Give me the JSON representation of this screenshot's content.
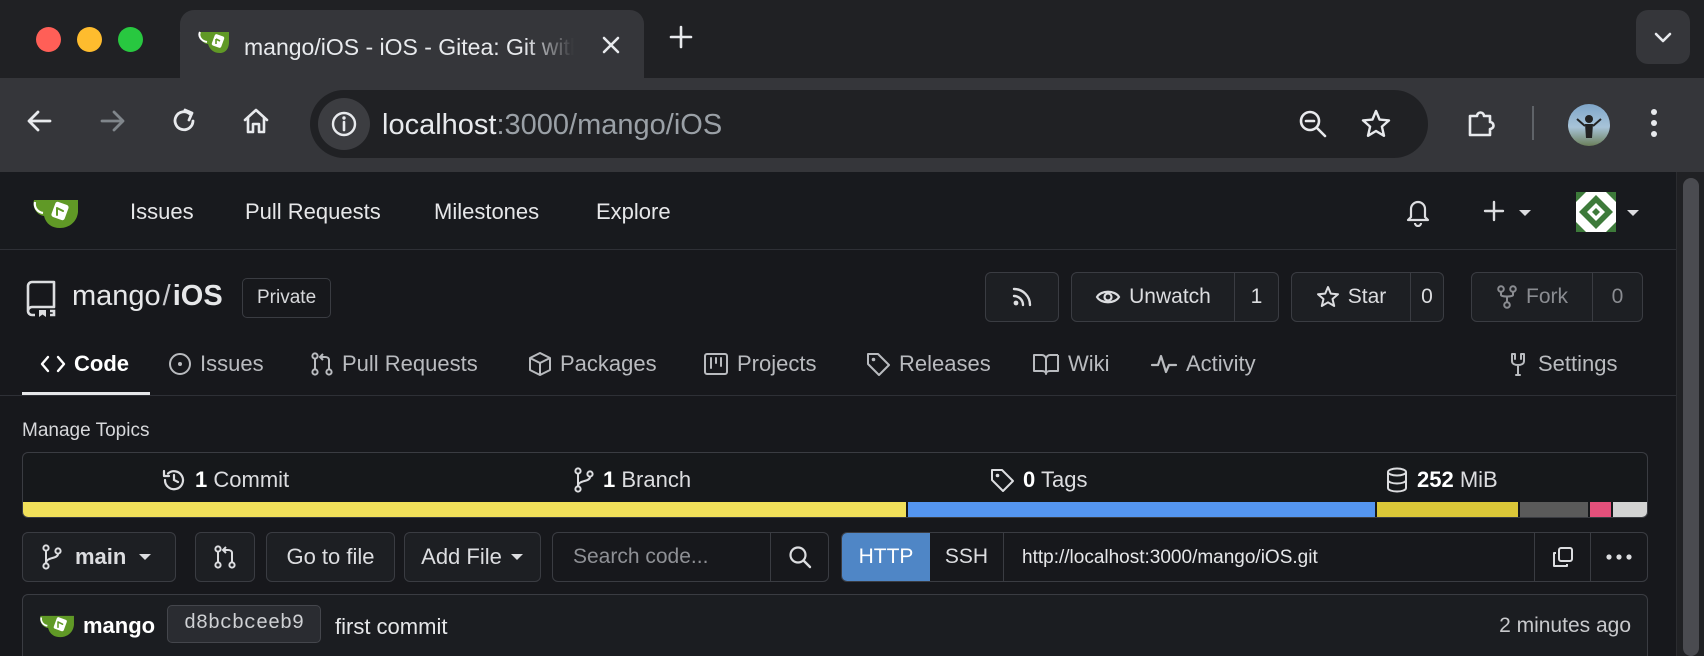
{
  "browser": {
    "tab_title": "mango/iOS - iOS - Gitea: Git with a cup of tea",
    "url_host": "localhost",
    "url_rest": ":3000/mango/iOS"
  },
  "navbar": {
    "items": [
      "Issues",
      "Pull Requests",
      "Milestones",
      "Explore"
    ]
  },
  "repo": {
    "owner": "mango",
    "separator": "/",
    "name": "iOS",
    "visibility": "Private"
  },
  "actions": {
    "unwatch_label": "Unwatch",
    "watch_count": "1",
    "star_label": "Star",
    "star_count": "0",
    "fork_label": "Fork",
    "fork_count": "0"
  },
  "tabs": [
    "Code",
    "Issues",
    "Pull Requests",
    "Packages",
    "Projects",
    "Releases",
    "Wiki",
    "Activity",
    "Settings"
  ],
  "manage_topics": "Manage Topics",
  "stats": {
    "commits_count": "1",
    "commits_label": "Commit",
    "branches_count": "1",
    "branches_label": "Branch",
    "tags_count": "0",
    "tags_label": "Tags",
    "size_value": "252",
    "size_unit": "MiB"
  },
  "language_bar": [
    {
      "color": "#f1e05a",
      "percent": 54.5
    },
    {
      "color": "#5495f0",
      "percent": 28.9
    },
    {
      "color": "#dbc738",
      "percent": 8.8
    },
    {
      "color": "#5a5a5a",
      "percent": 4.3
    },
    {
      "color": "#e4507b",
      "percent": 1.4
    },
    {
      "color": "#d3d3d3",
      "percent": 2.1
    }
  ],
  "controls": {
    "branch": "main",
    "go_to_file": "Go to file",
    "add_file": "Add File",
    "search_placeholder": "Search code...",
    "http": "HTTP",
    "ssh": "SSH",
    "clone_url": "http://localhost:3000/mango/iOS.git"
  },
  "commit": {
    "author": "mango",
    "sha": "d8bcbceeb9",
    "message": "first commit",
    "time": "2 minutes ago"
  }
}
